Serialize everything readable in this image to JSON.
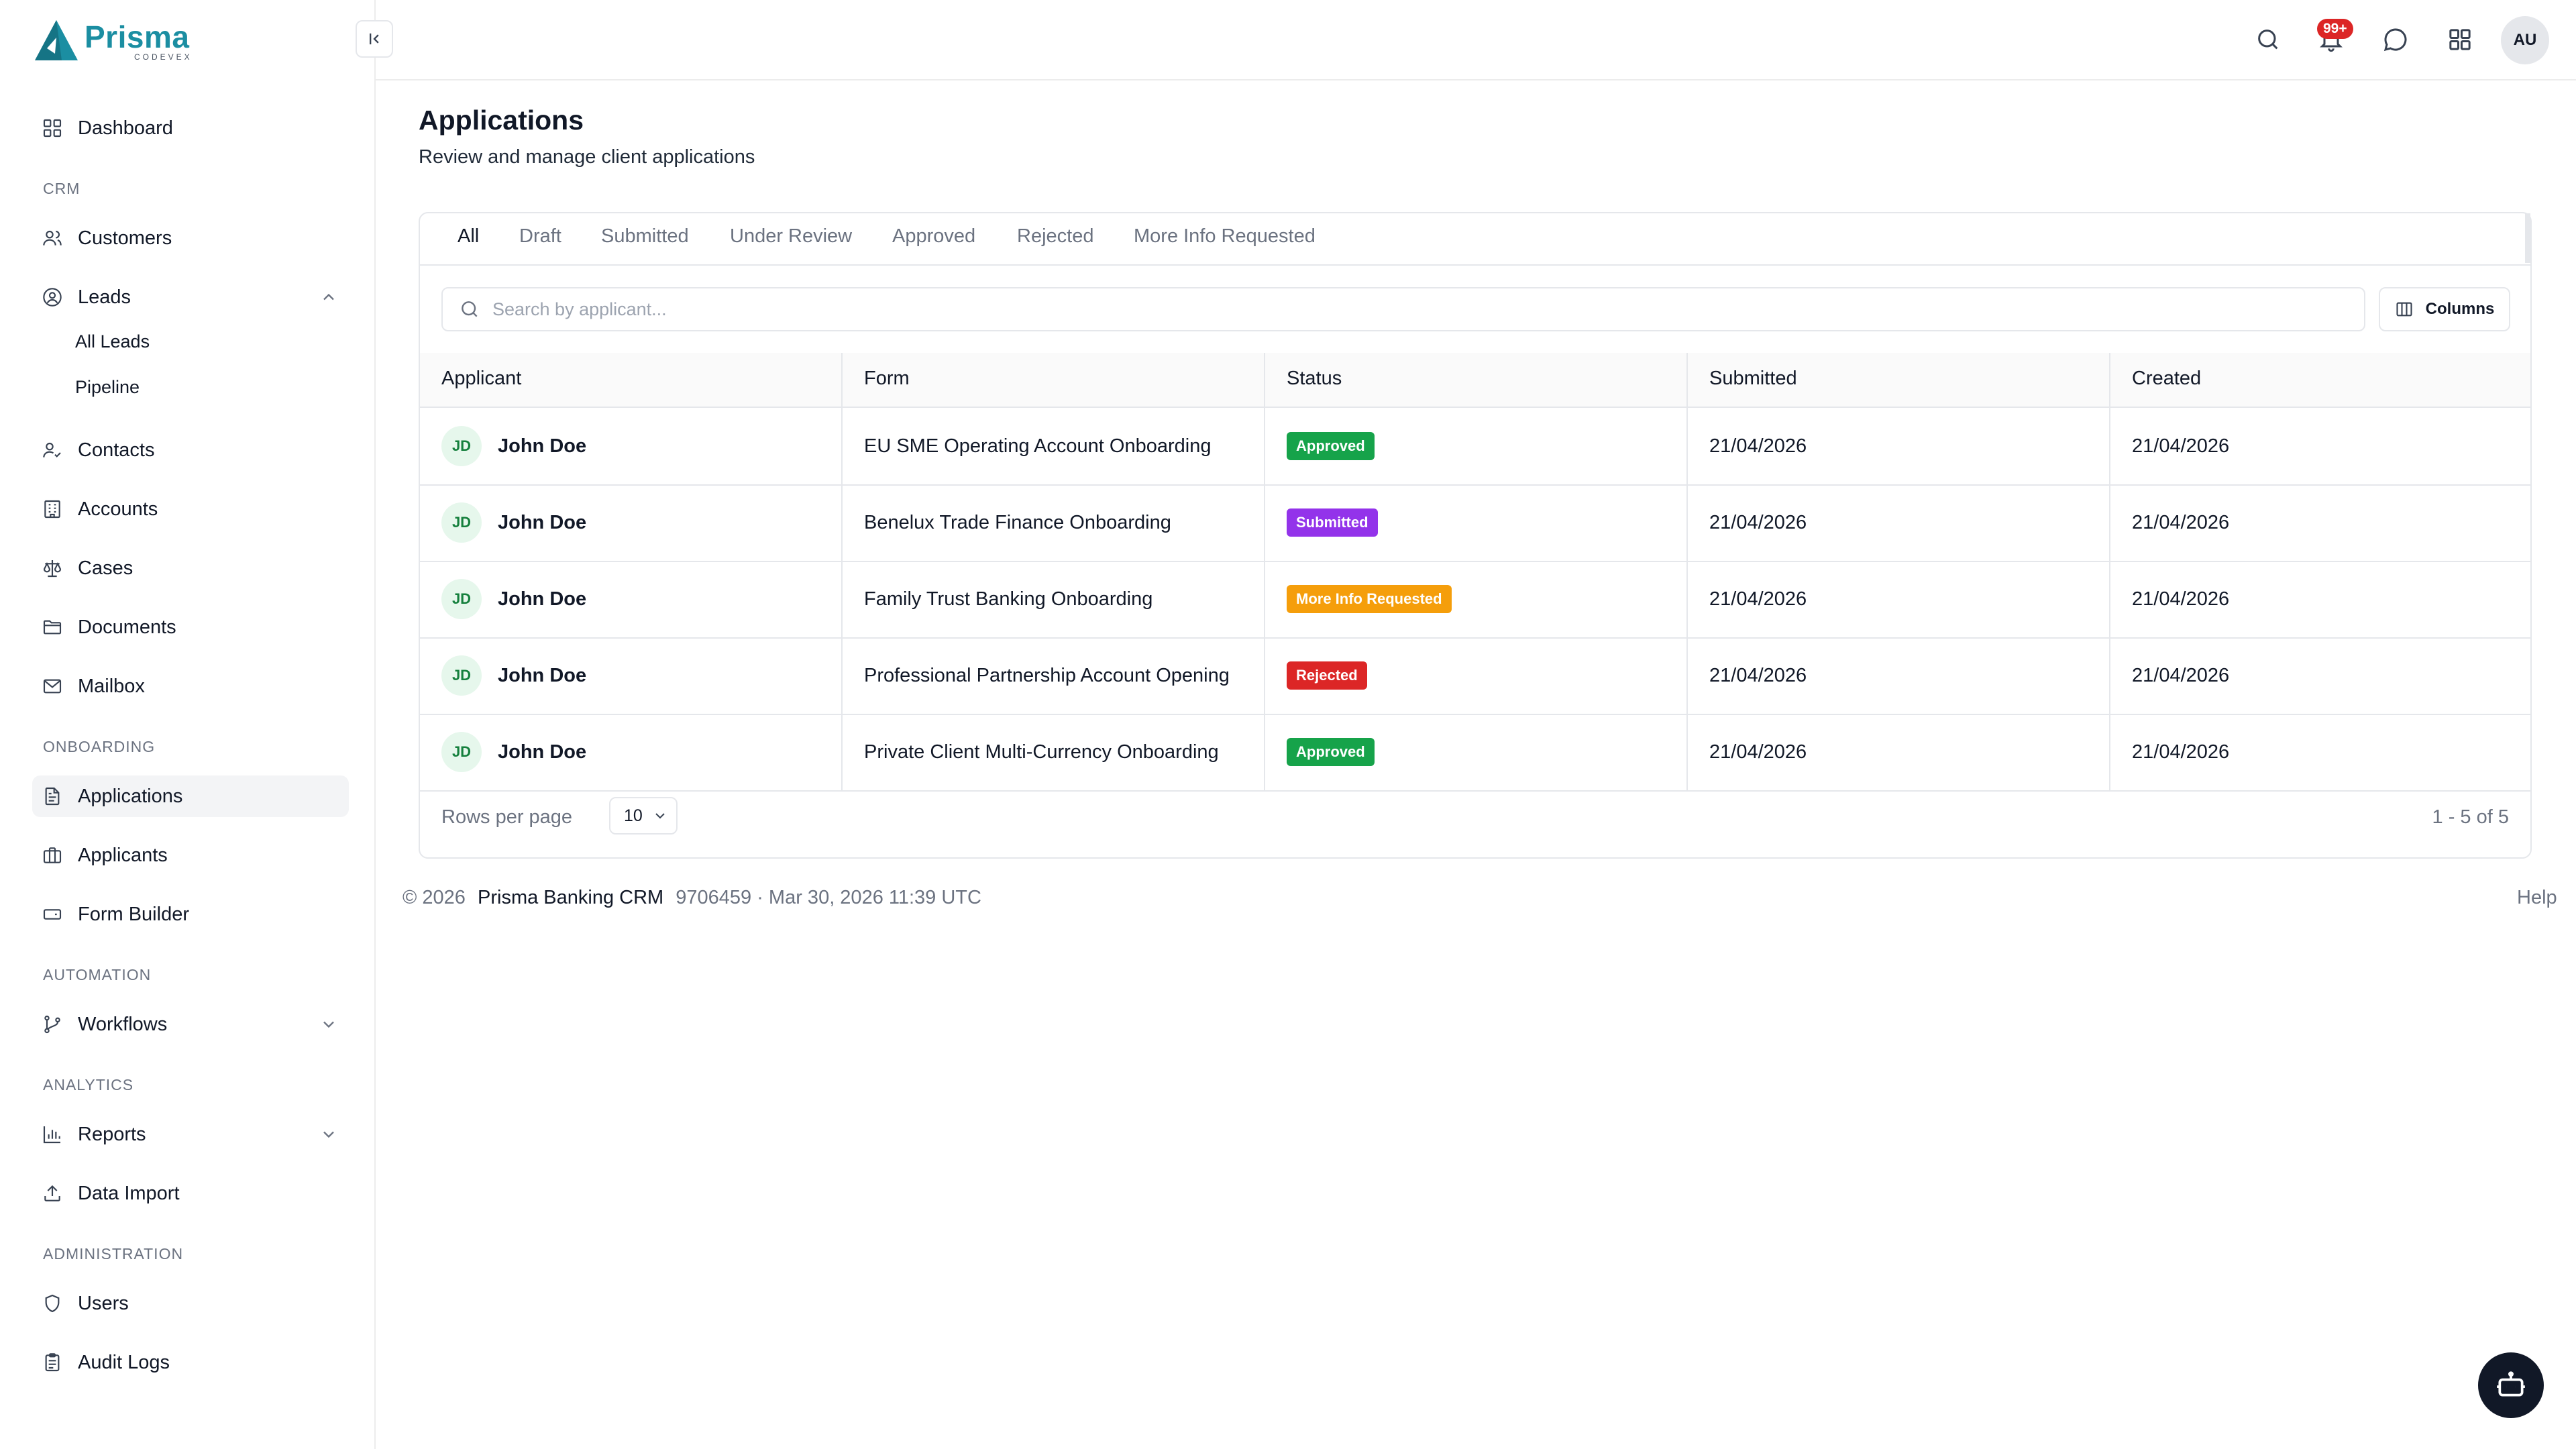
{
  "app": {
    "logo_name": "Prisma",
    "logo_sub": "CODEVEX",
    "brand_color": "#1b8ea2"
  },
  "sidebar": {
    "dashboard": "Dashboard",
    "sections": {
      "crm": "CRM",
      "onboarding": "ONBOARDING",
      "automation": "AUTOMATION",
      "analytics": "ANALYTICS",
      "administration": "ADMINISTRATION"
    },
    "customers": "Customers",
    "leads": "Leads",
    "leads_sub": [
      "All Leads",
      "Pipeline"
    ],
    "contacts": "Contacts",
    "accounts": "Accounts",
    "cases": "Cases",
    "documents": "Documents",
    "mailbox": "Mailbox",
    "applications": "Applications",
    "applicants": "Applicants",
    "form_builder": "Form Builder",
    "workflows": "Workflows",
    "reports": "Reports",
    "data_import": "Data Import",
    "users": "Users",
    "audit_logs": "Audit Logs"
  },
  "topbar": {
    "notification_badge": "99+",
    "user_initials": "AU"
  },
  "page": {
    "title": "Applications",
    "subtitle": "Review and manage client applications"
  },
  "tabs": [
    "All",
    "Draft",
    "Submitted",
    "Under Review",
    "Approved",
    "Rejected",
    "More Info Requested"
  ],
  "search": {
    "placeholder": "Search by applicant..."
  },
  "columns_button": "Columns",
  "table": {
    "headers": [
      "Applicant",
      "Form",
      "Status",
      "Submitted",
      "Created"
    ],
    "rows": [
      {
        "initials": "JD",
        "name": "John Doe",
        "form": "EU SME Operating Account Onboarding",
        "status": "Approved",
        "status_color": "#16a34a",
        "submitted": "21/04/2026",
        "created": "21/04/2026"
      },
      {
        "initials": "JD",
        "name": "John Doe",
        "form": "Benelux Trade Finance Onboarding",
        "status": "Submitted",
        "status_color": "#9333ea",
        "submitted": "21/04/2026",
        "created": "21/04/2026"
      },
      {
        "initials": "JD",
        "name": "John Doe",
        "form": "Family Trust Banking Onboarding",
        "status": "More Info Requested",
        "status_color": "#f59e0b",
        "submitted": "21/04/2026",
        "created": "21/04/2026"
      },
      {
        "initials": "JD",
        "name": "John Doe",
        "form": "Professional Partnership Account Opening",
        "status": "Rejected",
        "status_color": "#dc2626",
        "submitted": "21/04/2026",
        "created": "21/04/2026"
      },
      {
        "initials": "JD",
        "name": "John Doe",
        "form": "Private Client Multi-Currency Onboarding",
        "status": "Approved",
        "status_color": "#16a34a",
        "submitted": "21/04/2026",
        "created": "21/04/2026"
      }
    ]
  },
  "pagination": {
    "rows_per_page_label": "Rows per page",
    "rows_per_page": "10",
    "range": "1 - 5 of 5"
  },
  "footer": {
    "copyright": "© 2026",
    "brand": "Prisma Banking CRM",
    "meta": "9706459 · Mar 30, 2026 11:39 UTC",
    "help": "Help"
  }
}
